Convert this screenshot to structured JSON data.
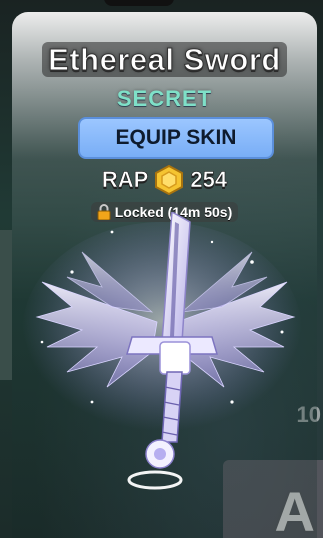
{
  "item": {
    "name": "Ethereal Sword",
    "rarity": "SECRET",
    "equip_label": "EQUIP SKIN",
    "rap_label": "RAP",
    "rap_value": "254",
    "lock_status": "Locked (14m 50s)"
  },
  "background": {
    "side_number": "10",
    "corner_letter": "A"
  },
  "icons": {
    "currency": "gold-hexagon-coin-icon",
    "lock": "padlock-icon"
  },
  "colors": {
    "rarity": "#7fe0c8",
    "equip_button": "#8ab9fb",
    "coin": "#f1b924"
  }
}
